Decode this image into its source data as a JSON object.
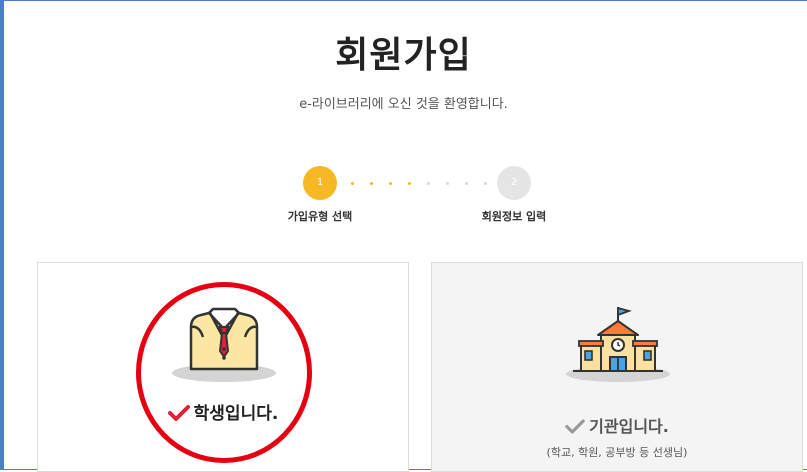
{
  "page": {
    "title": "회원가입",
    "subtitle": "e-라이브러리에 오신 것을 환영합니다."
  },
  "steps": [
    {
      "number": "1",
      "label": "가입유형 선택",
      "status": "active"
    },
    {
      "number": "2",
      "label": "회원정보 입력",
      "status": "pending"
    }
  ],
  "cards": {
    "student": {
      "label": "학생입니다.",
      "selected": true,
      "icon": "student-vest-icon"
    },
    "institution": {
      "label": "기관입니다.",
      "sublabel": "(학교, 학원, 공부방 등 선생님)",
      "selected": false,
      "icon": "school-building-icon"
    }
  },
  "colors": {
    "accent": "#f7b825",
    "check_selected": "#e0203a",
    "annotation": "#e50012"
  }
}
